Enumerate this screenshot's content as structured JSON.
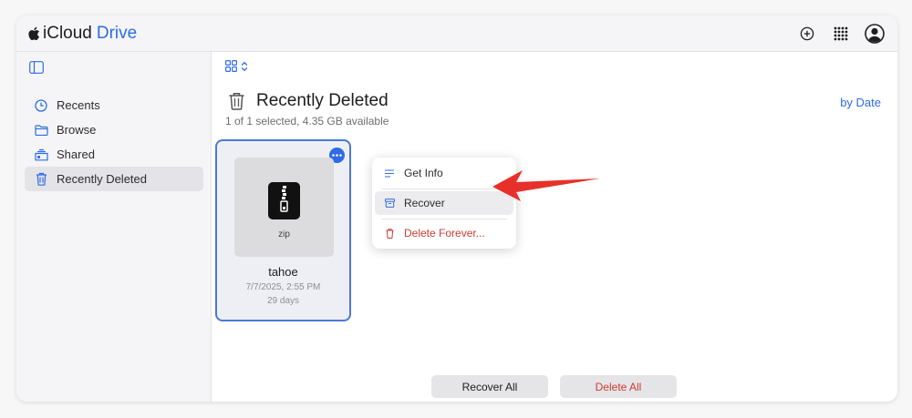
{
  "header": {
    "app_name": "iCloud",
    "app_suffix": "Drive",
    "accent_color": "#2e6be6",
    "icons": [
      "apple-logo-icon",
      "add-icon",
      "app-grid-icon",
      "account-icon"
    ]
  },
  "sidebar": {
    "toggle_icon": "sidebar-toggle-icon",
    "items": [
      {
        "label": "Recents",
        "icon": "clock-icon",
        "active": false
      },
      {
        "label": "Browse",
        "icon": "folder-icon",
        "active": false
      },
      {
        "label": "Shared",
        "icon": "shared-folder-icon",
        "active": false
      },
      {
        "label": "Recently Deleted",
        "icon": "trash-icon",
        "active": true
      }
    ]
  },
  "main": {
    "title": "Recently Deleted",
    "subtitle": "1 of 1 selected, 4.35 GB available",
    "sort_label": "by Date",
    "file": {
      "name": "tahoe",
      "type_label": "zip",
      "date": "7/7/2025, 2:55 PM",
      "days_left": "29 days",
      "selected": true
    },
    "context_menu": {
      "items": [
        {
          "label": "Get Info",
          "icon": "info-lines-icon"
        },
        {
          "label": "Recover",
          "icon": "recover-box-icon",
          "highlighted": true
        },
        {
          "label": "Delete Forever...",
          "icon": "trash-icon",
          "danger": true
        }
      ]
    },
    "buttons": {
      "recover_all": "Recover All",
      "delete_all": "Delete All",
      "danger_color": "#d03a2f"
    }
  }
}
